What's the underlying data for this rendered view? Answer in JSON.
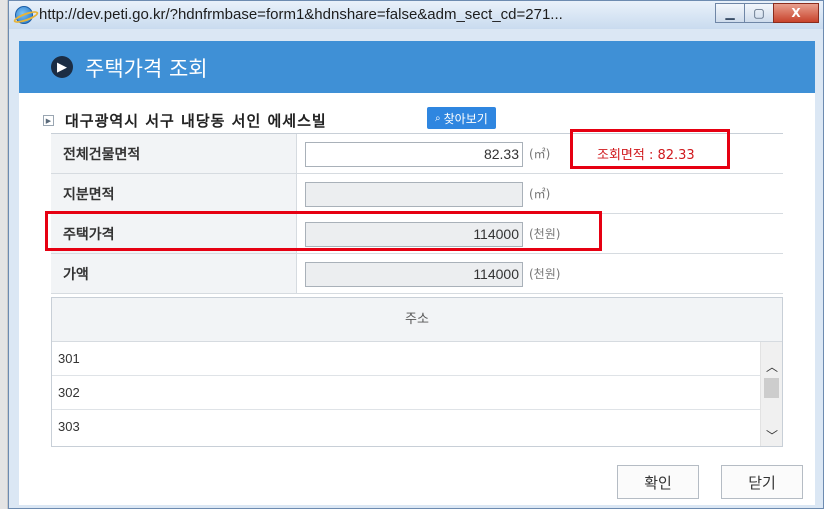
{
  "window": {
    "url": "http://dev.peti.go.kr/?hdnfrmbase=form1&hdnshare=false&adm_sect_cd=271...",
    "minimize_icon": "minimize-icon",
    "maximize_icon": "maximize-icon",
    "close_label": "X"
  },
  "popup": {
    "title": "주택가격 조회",
    "arrow_icon": "▶"
  },
  "building": {
    "name": "대구광역시 서구 내당동 서인 에세스빌",
    "search_label": "찾아보기",
    "search_icon": "🔍"
  },
  "form": {
    "total_area_label": "전체건물면적",
    "total_area_value": "82.33",
    "total_area_unit": "(㎡)",
    "inquiry_area_text": "조회면적 : 82.33",
    "share_area_label": "지분면적",
    "share_area_value": "",
    "share_area_unit": "(㎡)",
    "house_price_label": "주택가격",
    "house_price_value": "114000",
    "house_price_unit": "(천원)",
    "price_label": "가액",
    "price_value": "114000",
    "price_unit": "(천원)"
  },
  "address": {
    "header": "주소",
    "items": [
      "301",
      "302",
      "303"
    ],
    "scroll_up_icon": "︿",
    "scroll_down_icon": "﹀"
  },
  "buttons": {
    "confirm": "확인",
    "close": "닫기"
  },
  "colors": {
    "header_blue": "#3f90d6",
    "highlight_red": "#e60012",
    "search_button": "#2f86e0"
  }
}
